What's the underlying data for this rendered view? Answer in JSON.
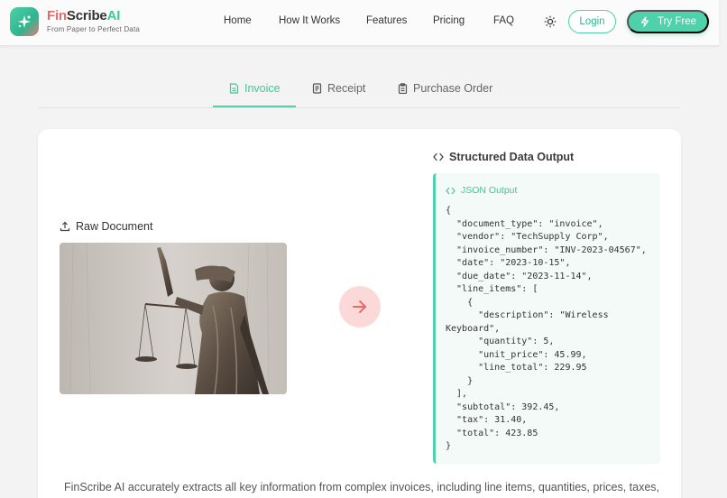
{
  "brand": {
    "fin": "Fin",
    "scribe": "Scribe",
    "ai": "AI",
    "tagline": "From Paper to Perfect Data"
  },
  "nav": {
    "items": [
      "Home",
      "How It Works",
      "Features",
      "Pricing",
      "FAQ"
    ]
  },
  "header": {
    "theme_icon": "sun-icon",
    "login_label": "Login",
    "try_label": "Try Free"
  },
  "tabs": [
    {
      "label": "Invoice",
      "icon": "document-icon",
      "active": true
    },
    {
      "label": "Receipt",
      "icon": "receipt-icon",
      "active": false
    },
    {
      "label": "Purchase Order",
      "icon": "clipboard-icon",
      "active": false
    }
  ],
  "raw": {
    "title": "Raw Document",
    "icon": "upload-icon"
  },
  "output": {
    "title": "Structured Data Output",
    "label": "JSON Output",
    "code": "{\n  \"document_type\": \"invoice\",\n  \"vendor\": \"TechSupply Corp\",\n  \"invoice_number\": \"INV-2023-04567\",\n  \"date\": \"2023-10-15\",\n  \"due_date\": \"2023-11-14\",\n  \"line_items\": [\n    {\n      \"description\": \"Wireless\nKeyboard\",\n      \"quantity\": 5,\n      \"unit_price\": 45.99,\n      \"line_total\": 229.95\n    }\n  ],\n  \"subtotal\": 392.45,\n  \"tax\": 31.40,\n  \"total\": 423.85\n}"
  },
  "description": "FinScribe AI accurately extracts all key information from complex invoices, including line items, quantities, prices, taxes,",
  "colors": {
    "accent": "#4fd1ab",
    "brand_red": "#e56b6b",
    "arrow_bg": "#fbd9d9"
  }
}
